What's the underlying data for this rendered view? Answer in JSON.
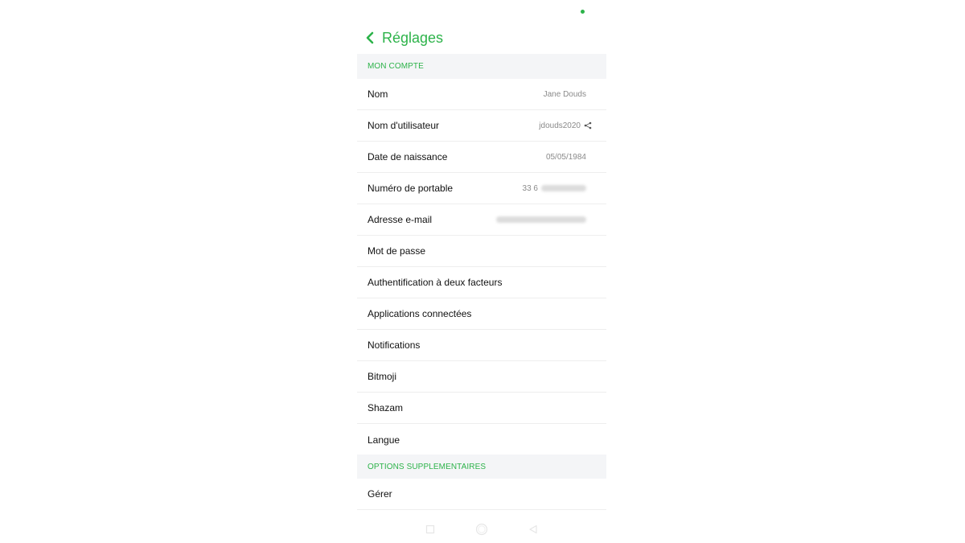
{
  "header": {
    "title": "Réglages",
    "back_icon": "chevron-left-icon"
  },
  "colors": {
    "accent": "#2db34a",
    "section_bg": "#f4f5f7",
    "value_text": "#8a8a8a"
  },
  "sections": [
    {
      "title": "MON COMPTE",
      "items": [
        {
          "label": "Nom",
          "value": "Jane Douds"
        },
        {
          "label": "Nom d'utilisateur",
          "value": "jdouds2020",
          "icon": "share-icon"
        },
        {
          "label": "Date de naissance",
          "value": "05/05/1984"
        },
        {
          "label": "Numéro de portable",
          "value": "33 6",
          "blurred": true
        },
        {
          "label": "Adresse e-mail",
          "value": "",
          "blurred": true
        },
        {
          "label": "Mot de passe"
        },
        {
          "label": "Authentification à deux facteurs"
        },
        {
          "label": "Applications connectées"
        },
        {
          "label": "Notifications"
        },
        {
          "label": "Bitmoji"
        },
        {
          "label": "Shazam"
        },
        {
          "label": "Langue"
        }
      ]
    },
    {
      "title": "OPTIONS SUPPLEMENTAIRES",
      "items": [
        {
          "label": "Gérer"
        }
      ]
    }
  ],
  "nav": {
    "recents_icon": "square-icon",
    "home_icon": "circle-icon",
    "back_icon": "triangle-back-icon"
  }
}
